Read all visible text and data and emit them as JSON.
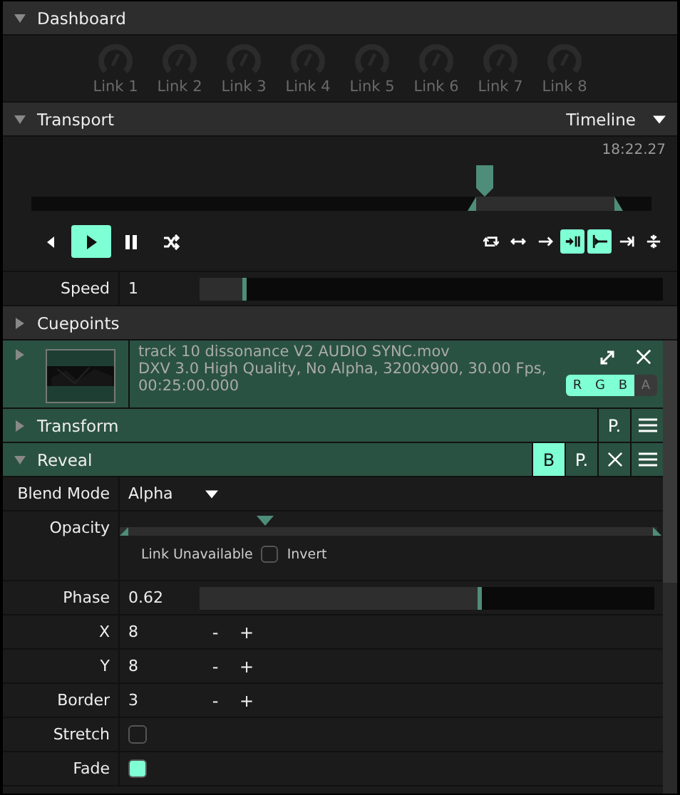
{
  "dashboard": {
    "title": "Dashboard",
    "expanded": true,
    "knobs": [
      {
        "label": "Link 1"
      },
      {
        "label": "Link 2"
      },
      {
        "label": "Link 3"
      },
      {
        "label": "Link 4"
      },
      {
        "label": "Link 5"
      },
      {
        "label": "Link 6"
      },
      {
        "label": "Link 7"
      },
      {
        "label": "Link 8"
      }
    ]
  },
  "transport": {
    "title": "Transport",
    "expanded": true,
    "mode": "Timeline",
    "time": "18:22.27",
    "playhead": {
      "level": 0.73
    },
    "in_marker": {
      "level": 0.717
    },
    "out_marker": {
      "level": 0.94
    },
    "left_controls": [
      {
        "kind": "previous",
        "selected": false
      },
      {
        "kind": "play",
        "selected": true
      },
      {
        "kind": "pause",
        "selected": false
      },
      {
        "kind": "random",
        "selected": false
      }
    ],
    "right_controls": [
      {
        "kind": "loop",
        "selected": false
      },
      {
        "kind": "bounce",
        "selected": false
      },
      {
        "kind": "forward",
        "selected": false
      },
      {
        "kind": "hold",
        "selected": true
      },
      {
        "kind": "start",
        "selected": true
      },
      {
        "kind": "jump",
        "selected": false
      },
      {
        "kind": "center",
        "selected": false
      }
    ]
  },
  "speed": {
    "label": "Speed",
    "value": "1",
    "level": 0.1
  },
  "cuepoints": {
    "title": "Cuepoints",
    "expanded": false
  },
  "clip": {
    "expanded": false,
    "name": "track 10 dissonance V2 AUDIO SYNC.mov",
    "info": "DXV 3.0 High Quality, No Alpha, 3200x900, 30.00 Fps, 00:25:00.000",
    "channels": [
      {
        "label": "R",
        "on": true
      },
      {
        "label": "G",
        "on": true
      },
      {
        "label": "B",
        "on": true
      },
      {
        "label": "A",
        "on": false
      }
    ]
  },
  "effects": [
    {
      "title": "Transform",
      "expanded": false,
      "preset": "P.",
      "removable": false
    },
    {
      "title": "Reveal",
      "expanded": true,
      "bypass": {
        "label": "B",
        "selected": true
      },
      "preset": "P.",
      "removable": true
    }
  ],
  "params": [
    {
      "kind": "dropdown",
      "label": "Blend Mode",
      "value": "Alpha"
    },
    {
      "kind": "range",
      "label": "Opacity",
      "level": 0.27,
      "link": "Link Unavailable",
      "invert": {
        "label": "Invert",
        "checked": false
      }
    },
    {
      "kind": "slider",
      "label": "Phase",
      "value": "0.62",
      "level": 0.62
    },
    {
      "kind": "number",
      "label": "X",
      "value": "8",
      "decrement": "-",
      "increment": "+"
    },
    {
      "kind": "number",
      "label": "Y",
      "value": "8",
      "decrement": "-",
      "increment": "+"
    },
    {
      "kind": "number",
      "label": "Border",
      "value": "3",
      "decrement": "-",
      "increment": "+"
    },
    {
      "kind": "checkbox",
      "label": "Stretch",
      "checked": false
    },
    {
      "kind": "checkbox",
      "label": "Fade",
      "checked": true
    }
  ]
}
